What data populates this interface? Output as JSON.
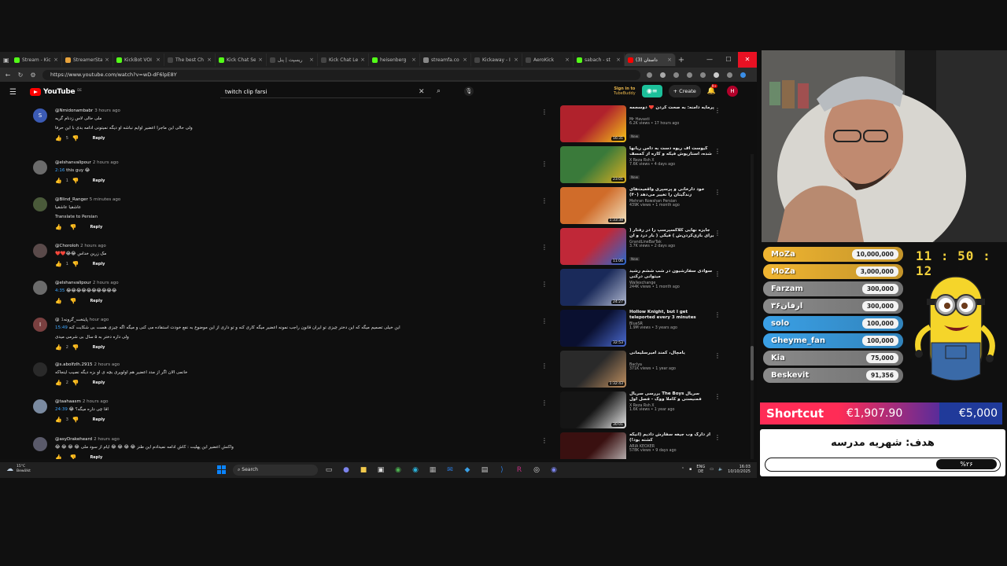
{
  "browser": {
    "tabs": [
      {
        "label": "Stream - Kic",
        "color": "#53fc18"
      },
      {
        "label": "StreamerSta",
        "color": "#e8a33c"
      },
      {
        "label": "KickBot VOI",
        "color": "#53fc18"
      },
      {
        "label": "The best Ch",
        "color": "#444444"
      },
      {
        "label": "Kick Chat Se",
        "color": "#53fc18"
      },
      {
        "label": "ریسپت | پنل",
        "color": "#444444"
      },
      {
        "label": "Kick Chat Le",
        "color": "#444444"
      },
      {
        "label": "heisenberg",
        "color": "#53fc18"
      },
      {
        "label": "streamfa.co",
        "color": "#888888"
      },
      {
        "label": "Kickaway - I",
        "color": "#444444"
      },
      {
        "label": "AeroKick",
        "color": "#444444"
      },
      {
        "label": "sabach - st",
        "color": "#53fc18"
      },
      {
        "label": "(3) داستان",
        "color": "#ff0000",
        "active": true
      }
    ],
    "new_tab": "+",
    "url": "https://www.youtube.com/watch?v=wD-dF6lpE8Y"
  },
  "youtube": {
    "logo_text": "YouTube",
    "region": "DE",
    "search_value": "twitch clip farsi",
    "signin_line1": "Sign in to",
    "signin_line2": "TubeBuddy",
    "create_label": "Create",
    "notifications_badge": "9+",
    "avatar_letter": "H"
  },
  "comments": [
    {
      "author": "@Nmidonambabr",
      "time": "3 hours ago",
      "lines": [
        "ملی حالی لاس زدنام گریه",
        "ولی حالی این ماجرا اعضیر اوایم نباشه او دیگه نمیتونی ادامه بدی با این حرفا"
      ],
      "likes": "5",
      "avatar": "S",
      "avatar_color": "#3b5bb5"
    },
    {
      "author": "@elshanvalipour",
      "time": "2 hours ago",
      "lines": [
        "2:16 this guy 😂"
      ],
      "likes": "1",
      "avatar": "",
      "avatar_color": "#6b6b6b"
    },
    {
      "author": "@Blind_Ranger",
      "time": "5 minutes ago",
      "lines": [
        "عاشقیا عاشقیا",
        "Translate to Persian"
      ],
      "likes": "",
      "avatar": "",
      "avatar_color": "#4a5a3a"
    },
    {
      "author": "@Choroloh",
      "time": "2 hours ago",
      "lines": [
        "❤️❤️😂😂 مک زرین خداس"
      ],
      "likes": "1",
      "avatar": "",
      "avatar_color": "#5a4a4a"
    },
    {
      "author": "@elshanvalipour",
      "time": "2 hours ago",
      "lines": [
        "4:35 😂😂😂😂😂😂😂😂😂😂"
      ],
      "likes": "",
      "avatar": "",
      "avatar_color": "#6b6b6b"
    },
    {
      "author": "@پایتخت_گرونه",
      "time": "1 hour ago",
      "lines": [
        "15:49 این خیلی تصمیم میگه که این دختر چیزی تو ایران قانون راجب نمونه اعضیر میگه کاری کنه و تو داری از این موضوع به نفع خودت استفاده می کنی و میگه اگه چیزی هست بی شکایت کنه",
        "ولی داره دختر به ۵ سال بی شرمی میدی"
      ],
      "likes": "2",
      "avatar": "I",
      "avatar_color": "#7a4040"
    },
    {
      "author": "@s.abolfzlh.2915",
      "time": "2 hours ago",
      "lines": [
        "خانمی الان اگر از مدد اعضیر هم اولویری بچه ی او بزه دیگه نصیب اینجاکه"
      ],
      "likes": "2",
      "avatar": "",
      "avatar_color": "#2a2a2a"
    },
    {
      "author": "@taahaasm",
      "time": "2 hours ago",
      "lines": [
        "24:39 😂 اقا چی داره میگه؟"
      ],
      "likes": "3",
      "avatar": "",
      "avatar_color": "#7a8aa0"
    },
    {
      "author": "@asyDrakeheard",
      "time": "2 hours ago",
      "lines": [
        "😂 😂 😂 😂 واکنش اعضیر این پهلیت : کاش ادامه نمیدادم این طنز 😂 😂 😂 😂 ایام از سود ملی"
      ],
      "likes": "",
      "avatar": "",
      "avatar_color": "#5a5a6a"
    }
  ],
  "related": [
    {
      "title": "پرمایه دامنه: به صحت کردن ❤️ دوسجمه",
      "channel": "Mr Havasti",
      "meta": "6.2K views • 17 hours ago",
      "duration": "16:31",
      "new": "New",
      "thumb": [
        "#b0222c",
        "#f5c518"
      ]
    },
    {
      "title": "گیوست اف ریوه دست به دامن ریانها شده، استارپوش فیکه و کاره از کمسف اف اس",
      "channel": "X Reza Rsh X",
      "meta": "7.6K views • 4 days ago",
      "duration": "23:01",
      "new": "New",
      "thumb": [
        "#3a7a3a",
        "#e0b020"
      ]
    },
    {
      "title": "خود دارخانی و پرسپری واقعیت‌های زندگیتان را تغییر می‌دهد (۴۰)",
      "channel": "Mehran Rowshan Persian",
      "meta": "439K views • 1 month ago",
      "duration": "1:33:38",
      "new": "",
      "thumb": [
        "#d06c2a",
        "#f2e3c0"
      ]
    },
    {
      "title": "جایزه نهایی کلاکسپرسپ را در رفتار ( برای بازی‌کردن‌ش ) فیکی ( بار درد و ان بیبی",
      "channel": "GrandLineBarTak",
      "meta": "3.7K views • 2 days ago",
      "duration": "11:06",
      "new": "New",
      "thumb": [
        "#c02838",
        "#2a6ad0"
      ]
    },
    {
      "title": "سوادی سفارشیون در شب ششم رشید میتوانی درکنی",
      "channel": "Wallexchange",
      "meta": "244K views • 1 month ago",
      "duration": "24:27",
      "new": "",
      "thumb": [
        "#1a2a5a",
        "#b0b8d0"
      ]
    },
    {
      "title": "Hollow Knight, but I get teleported every 3 minutes",
      "channel": "BlueSR",
      "meta": "1.9M views • 3 years ago",
      "duration": "32:53",
      "new": "",
      "thumb": [
        "#0a1030",
        "#4a6ad0"
      ]
    },
    {
      "title": "یامچال، کمند امیرسلیمانی",
      "channel": "Baclya",
      "meta": "371K views • 1 year ago",
      "duration": "1:32:43",
      "new": "",
      "thumb": [
        "#2a2a2a",
        "#c09060"
      ]
    },
    {
      "title": "بررسی سریال The Boys سریال فمنیستی و کاملا ووک - فصل اول",
      "channel": "X Reza Rsh X",
      "meta": "1.6K views • 1 year ago",
      "duration": "30:01",
      "new": "",
      "thumb": [
        "#151515",
        "#e8e8e8"
      ]
    },
    {
      "title": "از دارک وب جیغه سفارش دادیم (انیگه کشته بود!)",
      "channel": "ARIA KEOXER",
      "meta": "578K views • 9 days ago",
      "duration": "",
      "new": "",
      "thumb": [
        "#3a1010",
        "#d0d0d0"
      ]
    }
  ],
  "taskbar": {
    "weather_temp": "15°C",
    "weather_desc": "Bewölkt",
    "search_label": "Search",
    "lang_top": "ENG",
    "lang_bottom": "DE",
    "clock_time": "16:03",
    "clock_date": "10/10/2025"
  },
  "overlay": {
    "timer": "11 : 50 : 12",
    "donations": [
      {
        "name": "MoZa",
        "amount": "10,000,000",
        "color": "#f0b531"
      },
      {
        "name": "MoZa",
        "amount": "3,000,000",
        "color": "#f0b531"
      },
      {
        "name": "Farzam",
        "amount": "300,000",
        "color": "#8a8a8a"
      },
      {
        "name": "ارفان۳۶",
        "amount": "300,000",
        "color": "#8a8a8a"
      },
      {
        "name": "solo",
        "amount": "100,000",
        "color": "#3aa0e6"
      },
      {
        "name": "Gheyme_fan",
        "amount": "100,000",
        "color": "#3aa0e6"
      },
      {
        "name": "Kia",
        "amount": "75,000",
        "color": "#8a8a8a"
      },
      {
        "name": "Beskevit",
        "amount": "91,356",
        "color": "#8a8a8a"
      }
    ],
    "goal_title": "Shortcut",
    "goal_current": "€1,907.90",
    "goal_target": "€5,000",
    "goal_label": "هدف: شهریه مدرسه",
    "goal_percent_text": "%۲۶",
    "goal_fraction": 0.26
  }
}
